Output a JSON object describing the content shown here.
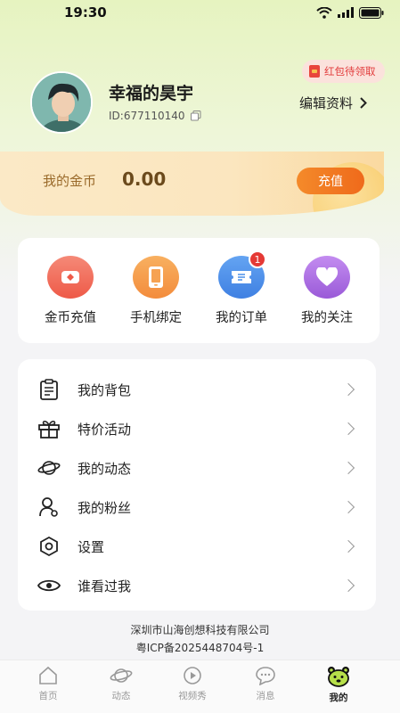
{
  "status_bar": {
    "time": "19:30"
  },
  "profile": {
    "username": "幸福的昊宇",
    "user_id": "ID:677110140",
    "redpack_badge": "红包待领取",
    "edit_profile": "编辑资料"
  },
  "coins": {
    "label": "我的金币",
    "value": "0.00",
    "recharge_button": "充值"
  },
  "quick_actions": [
    {
      "label": "金币充值",
      "icon": "coin-recharge-icon",
      "color": "#f06b5a"
    },
    {
      "label": "手机绑定",
      "icon": "phone-icon",
      "color": "#f59a4a"
    },
    {
      "label": "我的订单",
      "icon": "ticket-icon",
      "color": "#4a8fe8",
      "badge": "1"
    },
    {
      "label": "我的关注",
      "icon": "heart-icon",
      "color": "#a96ae0"
    }
  ],
  "menu": [
    {
      "label": "我的背包",
      "icon": "clipboard-icon"
    },
    {
      "label": "特价活动",
      "icon": "gift-icon"
    },
    {
      "label": "我的动态",
      "icon": "planet-icon"
    },
    {
      "label": "我的粉丝",
      "icon": "user-icon"
    },
    {
      "label": "设置",
      "icon": "settings-hexagon-icon"
    },
    {
      "label": "谁看过我",
      "icon": "eye-icon"
    }
  ],
  "footer": {
    "company": "深圳市山海创想科技有限公司",
    "icp": "粤ICP备2025448704号-1"
  },
  "tabs": [
    {
      "label": "首页",
      "icon": "home-icon"
    },
    {
      "label": "动态",
      "icon": "planet-icon"
    },
    {
      "label": "视频秀",
      "icon": "video-play-icon"
    },
    {
      "label": "消息",
      "icon": "chat-bubble-icon"
    },
    {
      "label": "我的",
      "icon": "bear-face-icon",
      "active": true
    }
  ]
}
